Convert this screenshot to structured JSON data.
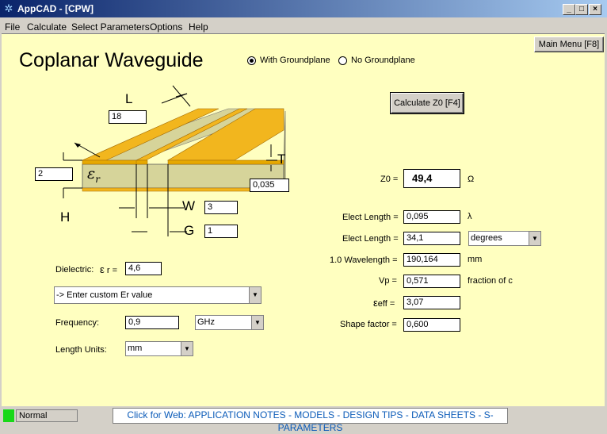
{
  "window": {
    "title": "AppCAD - [CPW]",
    "minimize": "_",
    "restore": "□",
    "close": "×"
  },
  "menu": {
    "items": [
      "File",
      "Calculate",
      "Select Parameters",
      "Options",
      "Help"
    ]
  },
  "header": {
    "title": "Coplanar Waveguide",
    "main_menu_button": "Main Menu [F8]",
    "radio_with": "With Groundplane",
    "radio_without": "No Groundplane",
    "with_groundplane_selected": true
  },
  "diagram": {
    "L_label": "L",
    "L_value": "18",
    "T_label": "T",
    "T_value": "0,035",
    "H_label": "H",
    "H_value": "2",
    "er_label": "ε",
    "er_sub": "r",
    "W_label": "W",
    "W_value": "3",
    "G_label": "G",
    "G_value": "1",
    "colors": {
      "metal": "#f2b61e",
      "metal_edge": "#c08000",
      "substrate": "#d6d49a",
      "substrate_dark": "#b4b276"
    }
  },
  "inputs": {
    "dielectric_label": "Dielectric:",
    "dielectric_symbol": "ε",
    "dielectric_sub": "r =",
    "dielectric_value": "4,6",
    "material_select": "-> Enter custom Er value",
    "frequency_label": "Frequency:",
    "frequency_value": "0,9",
    "frequency_unit": "GHz",
    "length_units_label": "Length Units:",
    "length_units_value": "mm"
  },
  "calculate_button": "Calculate Z0  [F4]",
  "results": {
    "z0_label": "Z0 =",
    "z0_value": "49,4",
    "z0_unit": "Ω",
    "elect_length_label": "Elect Length =",
    "elect_length_value": "0,095",
    "elect_length_unit": "λ",
    "elect_length_deg_label": "Elect Length =",
    "elect_length_deg_value": "34,1",
    "elect_length_deg_unit": "degrees",
    "wavelength_label": "1.0 Wavelength =",
    "wavelength_value": "190,164",
    "wavelength_unit": "mm",
    "vp_label": "Vp =",
    "vp_value": "0,571",
    "vp_unit": "fraction of c",
    "eeff_symbol": "ε",
    "eeff_sub": "eff =",
    "eeff_value": "3,07",
    "shape_label": "Shape factor =",
    "shape_value": "0,600"
  },
  "status": {
    "state": "Normal",
    "web_link": "Click for Web: APPLICATION NOTES - MODELS - DESIGN TIPS - DATA SHEETS - S-PARAMETERS"
  }
}
